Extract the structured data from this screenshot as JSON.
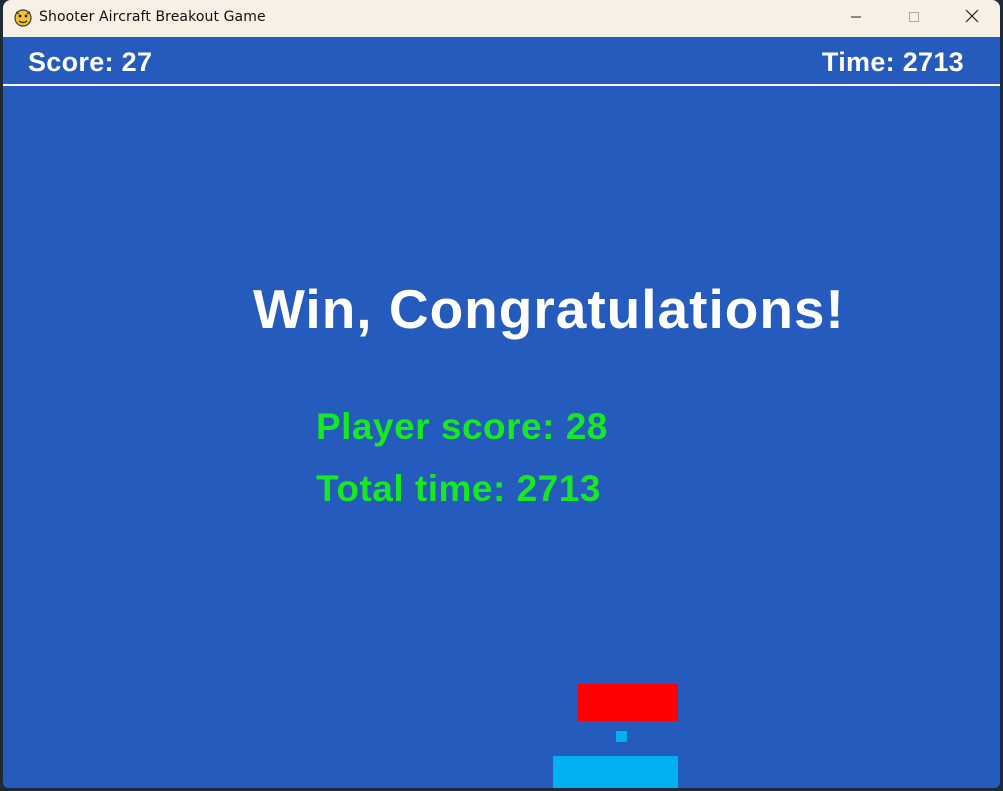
{
  "window": {
    "title": "Shooter Aircraft Breakout Game",
    "icon": "pygame-snake-icon",
    "controls": [
      "minimize-icon",
      "maximize-icon",
      "close-icon"
    ]
  },
  "hud": {
    "score_text": "Score: 27",
    "time_text": "Time: 2713"
  },
  "end_screen": {
    "headline": "Win, Congratulations!",
    "player_score_text": "Player score: 28",
    "total_time_text": "Total time: 2713"
  },
  "colors": {
    "background": "#245bbd",
    "hud_text": "#ffffff",
    "result_text": "#18e822",
    "brick": "#ff0000",
    "ball": "#00b0f0",
    "paddle": "#00b0f0"
  }
}
